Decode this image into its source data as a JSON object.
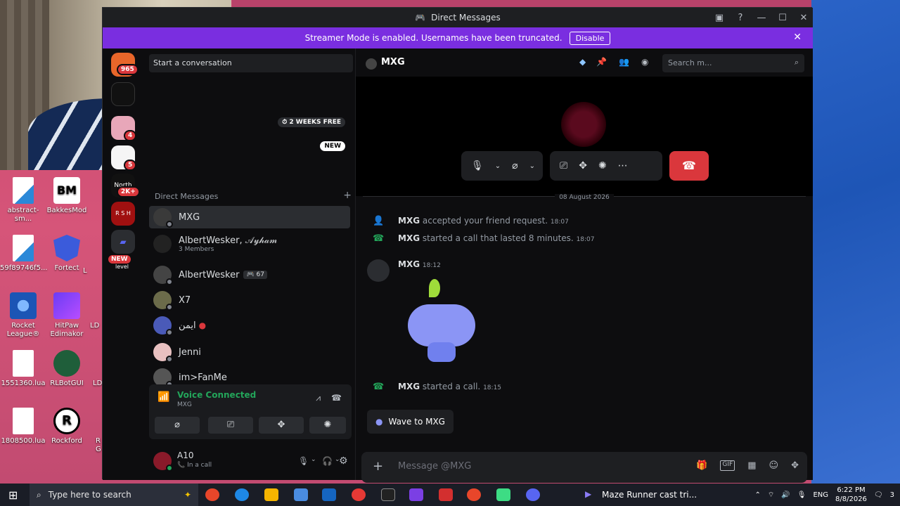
{
  "window": {
    "title": "Direct Messages",
    "streamer_banner": "Streamer Mode is enabled. Usernames have been truncated.",
    "disable_label": "Disable"
  },
  "rail": {
    "badges": [
      "965",
      "4",
      "5",
      "2K+",
      "NEW"
    ],
    "server_labels": [
      "North",
      "R S H",
      "level"
    ]
  },
  "sidebar": {
    "search_placeholder": "Start a conversation",
    "promo_nitro": "2 WEEKS FREE",
    "promo_new": "NEW",
    "dm_header": "Direct Messages",
    "add_icon": "+",
    "dms": [
      {
        "name": "MXG",
        "sub": "",
        "tag": ""
      },
      {
        "name": "AlbertWesker, 𝒜𝓎𝒽𝒶𝓂",
        "sub": "3 Members",
        "tag": ""
      },
      {
        "name": "AlbertWesker",
        "sub": "",
        "tag": "67"
      },
      {
        "name": "X7",
        "sub": "",
        "tag": ""
      },
      {
        "name": "ايمن",
        "sub": "",
        "tag": ""
      },
      {
        "name": "Jenni",
        "sub": "",
        "tag": ""
      },
      {
        "name": "im>FanMe",
        "sub": "",
        "tag": ""
      }
    ],
    "voice": {
      "title": "Voice Connected",
      "channel": "MXG"
    },
    "user": {
      "name": "A10",
      "status": "In a call"
    }
  },
  "main": {
    "channel_name": "MXG",
    "search_placeholder": "Search m...",
    "date_divider": "08 August 2026",
    "messages": [
      {
        "author": "MXG",
        "text": "accepted your friend request.",
        "time": "18:07"
      },
      {
        "author": "MXG",
        "text": "started a call that lasted 8 minutes.",
        "time": "18:07"
      },
      {
        "author": "MXG",
        "text": "",
        "time": "18:12"
      },
      {
        "author": "MXG",
        "text": "started a call.",
        "time": "18:15"
      }
    ],
    "wave_label": "Wave to MXG",
    "composer_placeholder": "Message @MXG",
    "composer_gif": "GIF"
  },
  "desktop": {
    "icons": [
      {
        "label": "abstract-sm..."
      },
      {
        "label": "BakkesMod"
      },
      {
        "label": "59f89746f5..."
      },
      {
        "label": "Fortect"
      },
      {
        "label": "Rocket League®"
      },
      {
        "label": "HitPaw Edimakor"
      },
      {
        "label": "1551360.lua"
      },
      {
        "label": "RLBotGUI"
      },
      {
        "label": "1808500.lua"
      },
      {
        "label": "Rockford"
      }
    ],
    "partial_labels": [
      "L",
      "LD",
      "LD",
      "R G"
    ]
  },
  "taskbar": {
    "search_placeholder": "Type here to search",
    "media_title": "Maze Runner cast tri...",
    "lang": "ENG",
    "time": "6:22 PM",
    "date": "8/8/2026",
    "notif_count": "3"
  },
  "colors": {
    "accent": "#5865f2",
    "streamer": "#7a2ee0",
    "danger": "#da373c",
    "online": "#23a55a"
  }
}
